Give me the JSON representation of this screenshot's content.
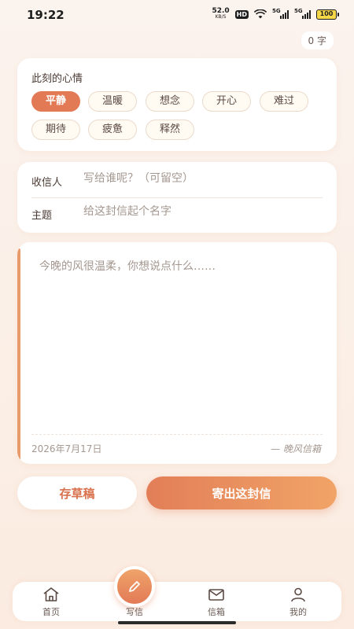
{
  "status_bar": {
    "time": "19:22",
    "net_speed_value": "52.0",
    "net_speed_unit": "KB/S",
    "hd": "HD",
    "sig1": "5G",
    "sig2": "5G",
    "battery": "100"
  },
  "word_count": "0 字",
  "mood": {
    "title": "此刻的心情",
    "chips": [
      "平静",
      "温暖",
      "想念",
      "开心",
      "难过",
      "期待",
      "疲惫",
      "释然"
    ],
    "selected": "平静"
  },
  "recipient": {
    "label": "收信人",
    "placeholder": "写给谁呢？（可留空）"
  },
  "subject": {
    "label": "主题",
    "placeholder": "给这封信起个名字"
  },
  "letter": {
    "placeholder": "今晚的风很温柔，你想说点什么……",
    "date": "2026年7月17日",
    "signature": "— 晚风信箱"
  },
  "actions": {
    "save_draft": "存草稿",
    "send": "寄出这封信"
  },
  "nav": {
    "home": "首页",
    "compose": "写信",
    "mailbox": "信箱",
    "mine": "我的"
  },
  "colors": {
    "accent": "#e27a56",
    "accent_light": "#f1a467",
    "background": "#fbf1ea"
  }
}
